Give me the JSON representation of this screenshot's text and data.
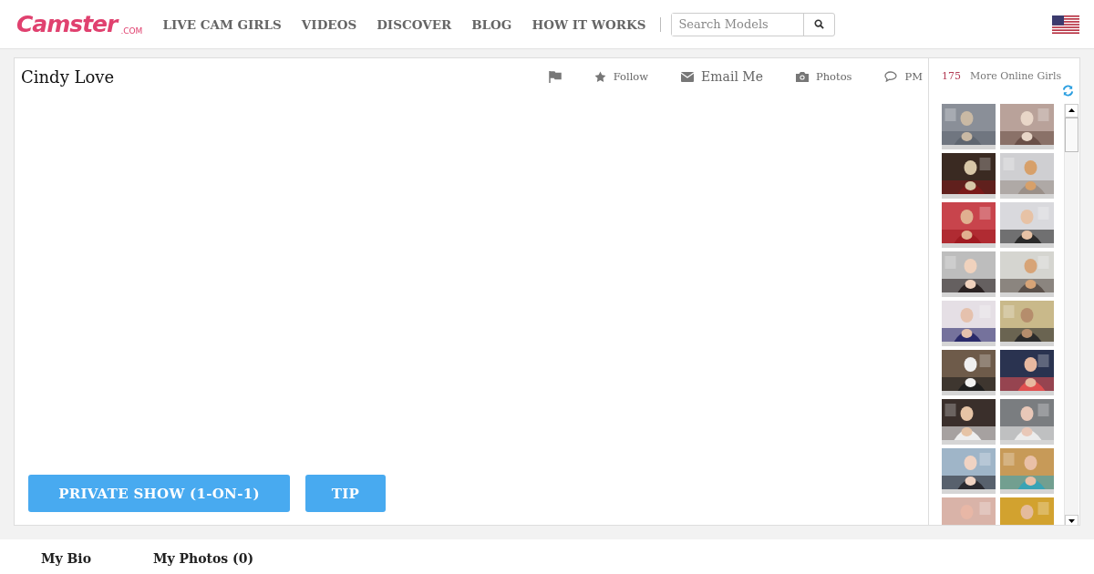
{
  "logo": {
    "text": "Camster",
    "suffix": ".COM"
  },
  "nav": [
    {
      "label": "LIVE CAM GIRLS"
    },
    {
      "label": "VIDEOS"
    },
    {
      "label": "DISCOVER"
    },
    {
      "label": "BLOG"
    },
    {
      "label": "HOW IT WORKS"
    }
  ],
  "search": {
    "placeholder": "Search Models"
  },
  "model": {
    "name": "Cindy Love"
  },
  "actions": [
    {
      "kind": "flag"
    },
    {
      "kind": "star",
      "label": "Follow"
    },
    {
      "kind": "mail",
      "label": "Email Me",
      "large": true
    },
    {
      "kind": "camera",
      "label": "Photos"
    },
    {
      "kind": "chat",
      "label": "PM"
    }
  ],
  "buttons": [
    {
      "label": "PRIVATE SHOW (1-ON-1)"
    },
    {
      "label": "TIP"
    }
  ],
  "online": {
    "count": "175",
    "label": "More Online Girls"
  },
  "profile_tabs": [
    {
      "label": "My Bio"
    },
    {
      "label": "My Photos (0)"
    }
  ]
}
